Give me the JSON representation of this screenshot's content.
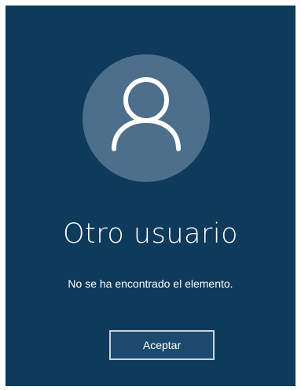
{
  "user": {
    "name": "Otro usuario",
    "avatar_icon": "user-silhouette-icon"
  },
  "dialog": {
    "message": "No se ha encontrado el elemento.",
    "ok_label": "Aceptar"
  },
  "colors": {
    "background": "#0e3a5c",
    "avatar_circle": "#4c6f8b",
    "button_background": "#1c4a6e",
    "button_border": "#c9d3dc",
    "text": "#ffffff"
  }
}
